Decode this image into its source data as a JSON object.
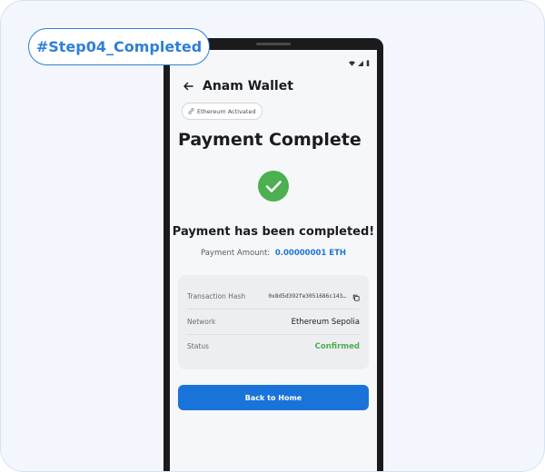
{
  "step_tag": "#Step04_Completed",
  "app": {
    "title": "Anam Wallet",
    "network_chip": "Ethereum Activated"
  },
  "page": {
    "title": "Payment Complete",
    "message": "Payment has been completed!",
    "amount_label": "Payment Amount:",
    "amount_value": "0.00000001 ETH"
  },
  "details": {
    "tx_hash_label": "Transaction Hash",
    "tx_hash_value": "0x8d5d392fe3051686c143…",
    "network_label": "Network",
    "network_value": "Ethereum Sepolia",
    "status_label": "Status",
    "status_value": "Confirmed"
  },
  "actions": {
    "home_label": "Back to Home"
  },
  "icons": {
    "back": "arrow-left-icon",
    "chip": "link-icon",
    "success": "check-circle-icon",
    "copy": "copy-icon",
    "status_bar": [
      "wifi-icon",
      "signal-icon",
      "battery-icon"
    ]
  },
  "colors": {
    "accent": "#1a73d8",
    "success": "#4caf50",
    "tag": "#2e7fd8"
  }
}
